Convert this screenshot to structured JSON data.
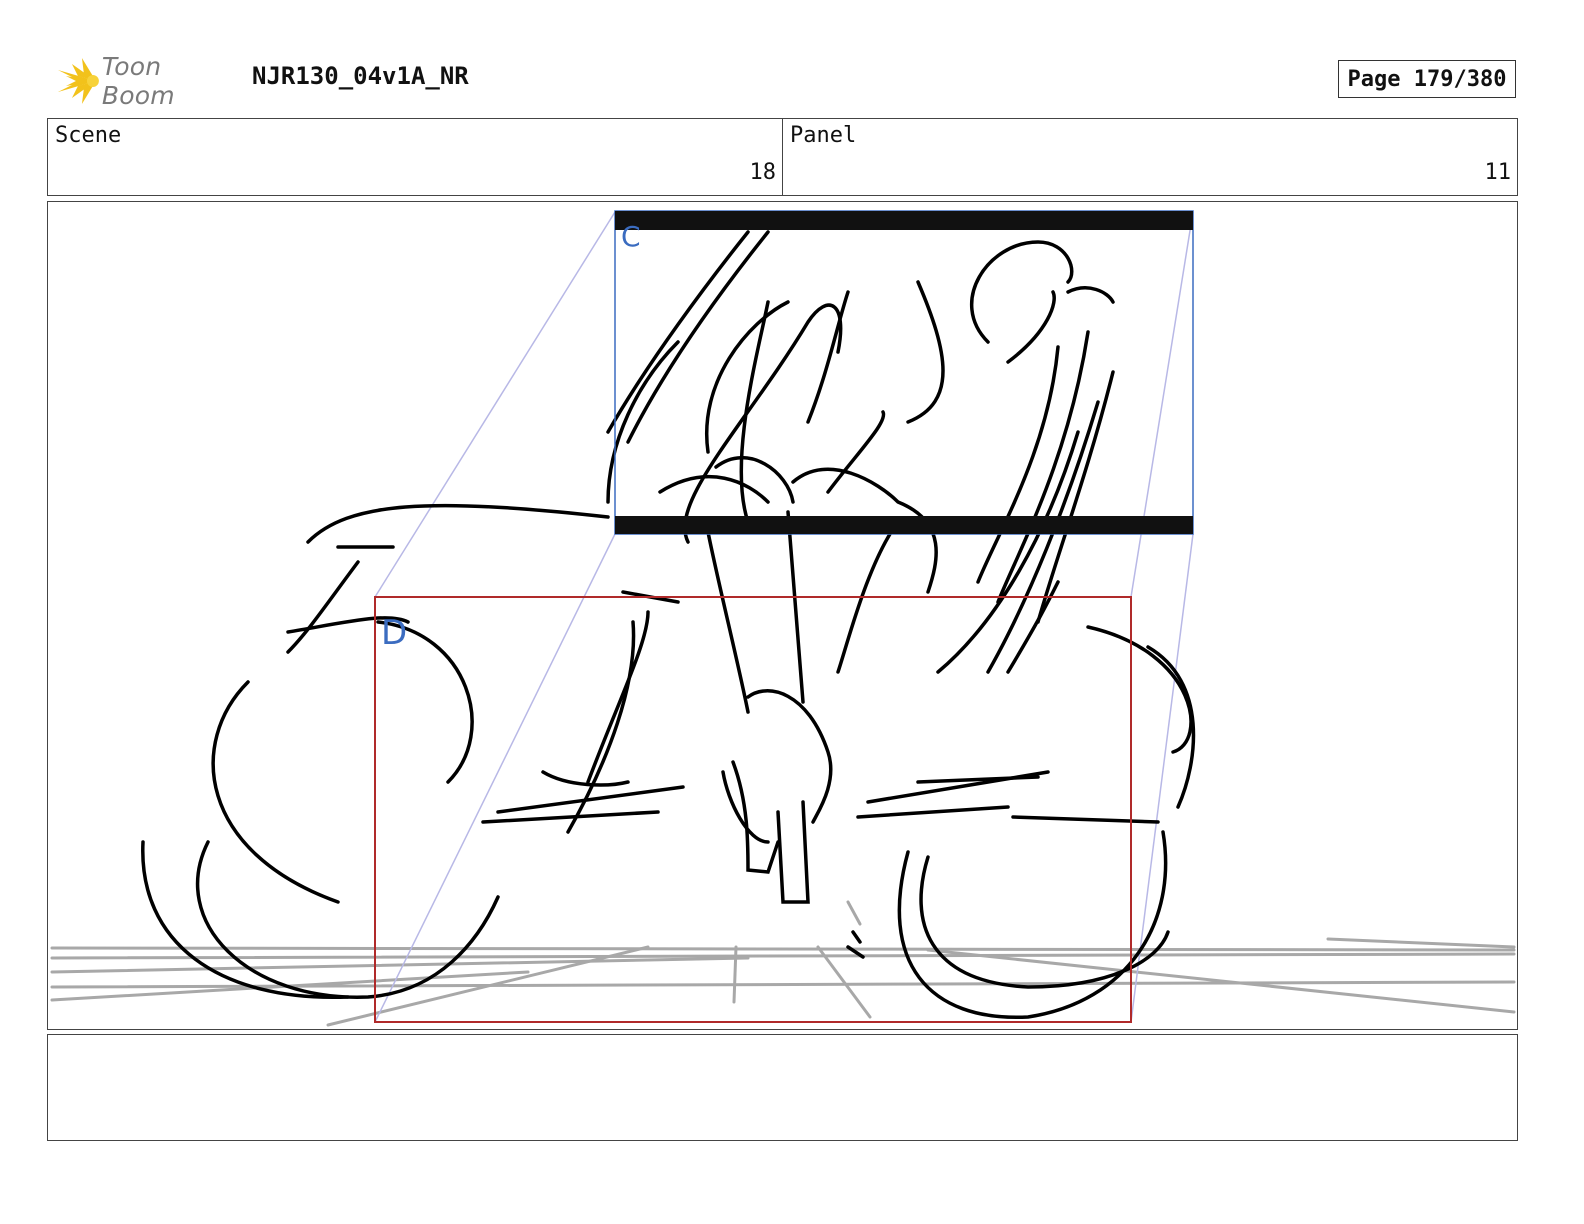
{
  "header": {
    "logo_text": "Toon Boom",
    "project_name": "NJR130_04v1A_NR",
    "page_indicator": "Page 179/380"
  },
  "info": {
    "scene_label": "Scene",
    "scene_value": "18",
    "panel_label": "Panel",
    "panel_value": "11"
  },
  "panel": {
    "camera_c_label": "C",
    "camera_d_label": "D",
    "colors": {
      "camera_c": "#3b6cc0",
      "camera_d": "#b02a2a",
      "ground_lines": "#a8a8a8",
      "sketch": "#000000",
      "logo_yellow": "#f2c21b"
    }
  },
  "notes": {
    "text": ""
  }
}
